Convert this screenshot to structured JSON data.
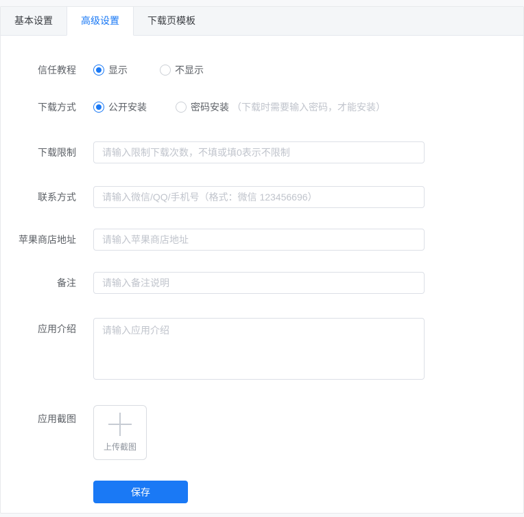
{
  "colors": {
    "accent": "#1a79f5",
    "tab_header_bg": "#f4f6f8",
    "border": "#dcdfe6",
    "placeholder": "#c0c4cc",
    "label_text": "#5c6066"
  },
  "tabs": [
    {
      "label": "基本设置",
      "active": false
    },
    {
      "label": "高级设置",
      "active": true
    },
    {
      "label": "下载页模板",
      "active": false
    }
  ],
  "form": {
    "trust_tutorial": {
      "label": "信任教程",
      "options": [
        {
          "label": "显示",
          "selected": true
        },
        {
          "label": "不显示",
          "selected": false
        }
      ]
    },
    "download_method": {
      "label": "下载方式",
      "options": [
        {
          "label": "公开安装",
          "selected": true
        },
        {
          "label": "密码安装",
          "selected": false,
          "hint": "（下载时需要输入密码，才能安装）"
        }
      ]
    },
    "download_limit": {
      "label": "下载限制",
      "placeholder": "请输入限制下载次数，不填或填0表示不限制",
      "value": ""
    },
    "contact": {
      "label": "联系方式",
      "placeholder": "请输入微信/QQ/手机号（格式：微信 123456696）",
      "value": ""
    },
    "appstore_url": {
      "label": "苹果商店地址",
      "placeholder": "请输入苹果商店地址",
      "value": ""
    },
    "remark": {
      "label": "备注",
      "placeholder": "请输入备注说明",
      "value": ""
    },
    "app_intro": {
      "label": "应用介绍",
      "placeholder": "请输入应用介绍",
      "value": ""
    },
    "app_screenshot": {
      "label": "应用截图",
      "upload_text": "上传截图",
      "icon": "plus-icon"
    },
    "save_label": "保存"
  }
}
